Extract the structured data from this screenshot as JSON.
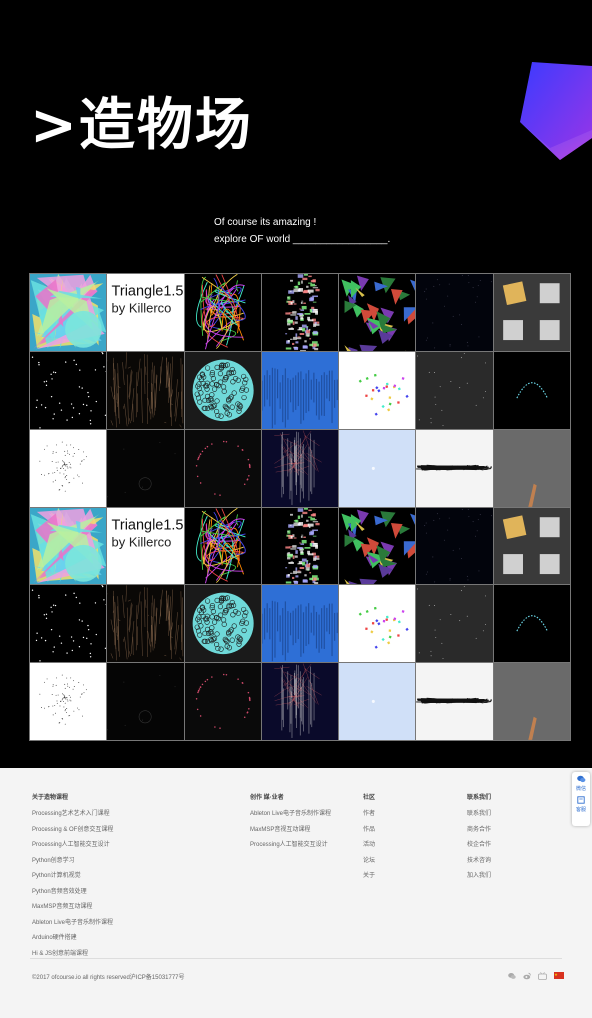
{
  "hero": {
    "title": ">造物场",
    "tagline_line1": "Of course its amazing !",
    "tagline_line2": "explore OF world _________________."
  },
  "gallery": {
    "tile_text": {
      "line1": "Triangle1.5",
      "line2": "by Killerco"
    },
    "tiles": [
      "flower",
      "text",
      "bundle",
      "column",
      "shards",
      "dots",
      "squares",
      "stars",
      "threads",
      "circle",
      "blue-spikes",
      "confetti",
      "dark-dots",
      "arc",
      "scatter",
      "faint-circle",
      "red-dots",
      "lines",
      "pale",
      "brush",
      "gray-stroke",
      "flower",
      "text",
      "bundle",
      "column",
      "shards",
      "dots",
      "squares",
      "stars",
      "threads",
      "circle",
      "blue-spikes",
      "confetti",
      "dark-dots",
      "arc",
      "scatter",
      "faint-circle",
      "red-dots",
      "lines",
      "pale",
      "brush",
      "gray-stroke"
    ]
  },
  "footer": {
    "col1": {
      "heading": "关于造物课程",
      "items": [
        "Processing艺术艺术入门课程",
        "Processing & OF创意交互课程",
        "Processing人工智能交互设计",
        "Python创意学习",
        "Python计算机视觉",
        "Python音频音效处理",
        "MaxMSP音频互动课程",
        "Ableton Live电子音乐制作课程",
        "Arduino硬件搭建",
        "Hi & JS创意前端课程"
      ]
    },
    "col2": {
      "heading": "创作 媒·业者",
      "items": [
        "Ableton Live电子音乐制作课程",
        "MaxMSP音视互动课程",
        "Processing人工智能交互设计"
      ]
    },
    "col3": {
      "heading": "社区",
      "items": [
        "作者",
        "作品",
        "活动",
        "论坛",
        "关于"
      ]
    },
    "col4": {
      "heading": "联系我们",
      "items": [
        "联系我们",
        "商务合作",
        "校企合作",
        "技术咨询",
        "加入我们"
      ]
    },
    "copyright": "©2017 ofcourse.io all rights reserved沪ICP备15031777号",
    "social": [
      "wechat-icon",
      "weibo-icon",
      "bilibili-icon",
      "flag-icon"
    ]
  },
  "side_widget": {
    "item1": "微信",
    "item2": "客服"
  }
}
